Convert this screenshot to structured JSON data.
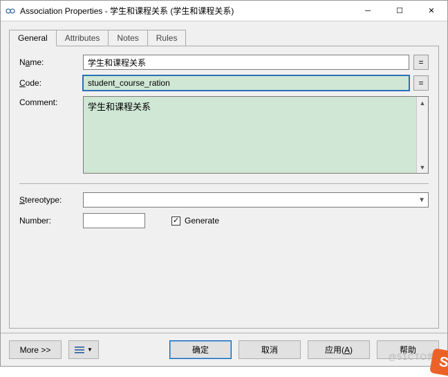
{
  "window": {
    "title": "Association Properties - 学生和课程关系 (学生和课程关系)"
  },
  "tabs": [
    {
      "label": "General"
    },
    {
      "label": "Attributes"
    },
    {
      "label": "Notes"
    },
    {
      "label": "Rules"
    }
  ],
  "labels": {
    "name_pre": "N",
    "name_ul": "a",
    "name_post": "me:",
    "code_ul": "C",
    "code_post": "ode:",
    "comment": "Comment:",
    "stereotype_ul": "S",
    "stereotype_post": "tereotype:",
    "number": "Number:",
    "generate_ul": "G",
    "generate_post": "enerate"
  },
  "fields": {
    "name": "学生和课程关系",
    "code": "student_course_ration",
    "comment": "学生和课程关系",
    "stereotype": "",
    "number": "",
    "generate_checked": true
  },
  "sqbtn": "=",
  "footer": {
    "more": "More >>",
    "ok": "确定",
    "cancel": "取消",
    "apply": "应用(A)",
    "apply_ul": "A",
    "help": "帮助"
  },
  "watermark": "@51CTO博客"
}
